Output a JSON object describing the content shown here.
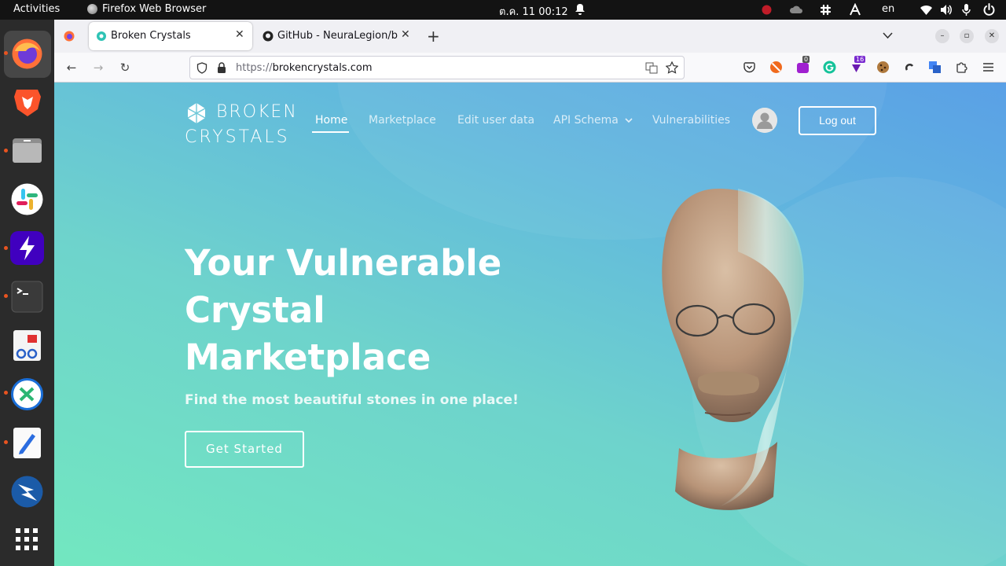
{
  "system": {
    "activities": "Activities",
    "app_name": "Firefox Web Browser",
    "clock": "ต.ค. 11  00:12",
    "language": "en"
  },
  "browser": {
    "tabs": [
      {
        "label": "Broken Crystals",
        "active": true
      },
      {
        "label": "GitHub - NeuraLegion/br",
        "active": false
      }
    ],
    "url_protocol": "https://",
    "url_host": "brokencrystals.com",
    "extension_badges": {
      "badge_1": "0",
      "badge_2": "16"
    }
  },
  "site": {
    "logo_line1": "BROKEN",
    "logo_line2": "CRYSTALS",
    "nav": {
      "home": "Home",
      "marketplace": "Marketplace",
      "edit_user_data": "Edit user data",
      "api_schema": "API Schema",
      "vulnerabilities": "Vulnerabilities"
    },
    "logout": "Log out",
    "hero": {
      "title_line1": "Your Vulnerable",
      "title_line2": "Crystal",
      "title_line3": "Marketplace",
      "subtitle": "Find the most beautiful stones in one place!",
      "cta": "Get Started"
    }
  },
  "colors": {
    "accent_orange": "#e95420",
    "page_gradient_top": "#5aa0e6",
    "page_gradient_bottom": "#72e7c0"
  }
}
